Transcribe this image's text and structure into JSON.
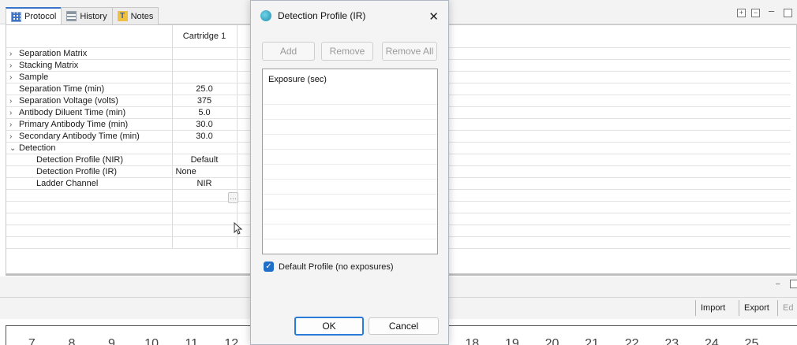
{
  "tabs": [
    {
      "label": "Protocol",
      "icon": "grid-icon",
      "active": true
    },
    {
      "label": "History",
      "icon": "history-icon",
      "active": false
    },
    {
      "label": "Notes",
      "icon": "notes-icon",
      "active": false
    }
  ],
  "protocol_table": {
    "column_header": "Cartridge 1",
    "rows": [
      {
        "label": "Separation Matrix",
        "value": "",
        "expander": "collapsed"
      },
      {
        "label": "Stacking Matrix",
        "value": "",
        "expander": "collapsed"
      },
      {
        "label": "Sample",
        "value": "",
        "expander": "collapsed"
      },
      {
        "label": "Separation Time (min)",
        "value": "25.0",
        "expander": "none"
      },
      {
        "label": "Separation Voltage (volts)",
        "value": "375",
        "expander": "collapsed"
      },
      {
        "label": "Antibody Diluent Time (min)",
        "value": "5.0",
        "expander": "collapsed"
      },
      {
        "label": "Primary Antibody Time (min)",
        "value": "30.0",
        "expander": "collapsed"
      },
      {
        "label": "Secondary Antibody Time (min)",
        "value": "30.0",
        "expander": "collapsed"
      },
      {
        "label": "Detection",
        "value": "",
        "expander": "expanded"
      },
      {
        "label": "Detection Profile (NIR)",
        "value": "Default",
        "expander": "child"
      },
      {
        "label": "Detection Profile (IR)",
        "value": "None",
        "expander": "child"
      },
      {
        "label": "Ladder Channel",
        "value": "NIR",
        "expander": "child"
      }
    ]
  },
  "lower_toolbar": {
    "import_label": "Import",
    "export_label": "Export",
    "edit_label": "Ed"
  },
  "number_strip": {
    "left": [
      "7",
      "8",
      "9",
      "10",
      "11",
      "12"
    ],
    "right": [
      "18",
      "19",
      "20",
      "21",
      "22",
      "23",
      "24",
      "25"
    ]
  },
  "dialog": {
    "title": "Detection Profile (IR)",
    "add_label": "Add",
    "remove_label": "Remove",
    "remove_all_label": "Remove All",
    "list_header": "Exposure (sec)",
    "default_checkbox_label": "Default Profile (no exposures)",
    "default_checked": true,
    "ok_label": "OK",
    "cancel_label": "Cancel"
  },
  "colors": {
    "accent": "#2b7bd8",
    "checkbox": "#1f6fc9"
  }
}
